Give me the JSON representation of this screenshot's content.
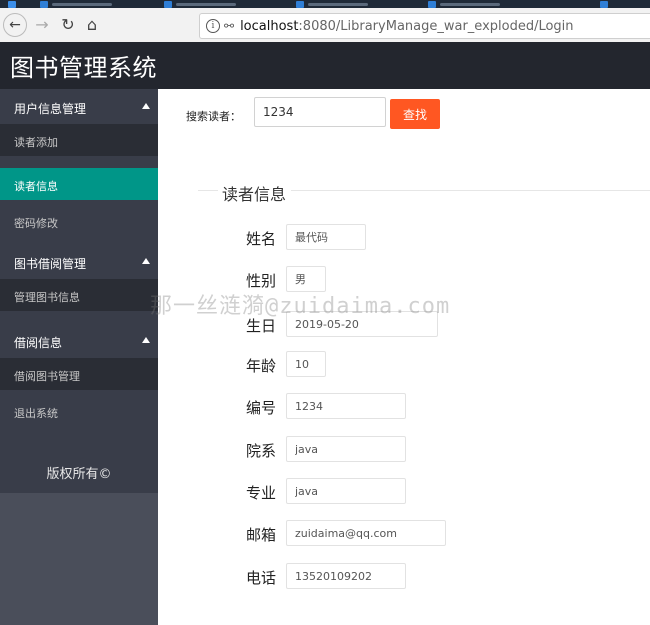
{
  "browser": {
    "url_host": "localhost",
    "url_path": ":8080/LibraryManage_war_exploded/Login"
  },
  "app": {
    "title": "图书管理系统"
  },
  "sidebar": {
    "group_user": "用户信息管理",
    "item_reader_add": "读者添加",
    "item_reader_info": "读者信息",
    "item_password": "密码修改",
    "group_borrow_manage": "图书借阅管理",
    "item_book_manage": "管理图书信息",
    "group_borrow_info": "借阅信息",
    "item_borrow_manage": "借阅图书管理",
    "item_logout": "退出系统",
    "copyright": "版权所有©"
  },
  "search": {
    "label": "搜索读者：",
    "value": "1234",
    "button": "查找"
  },
  "reader": {
    "legend": "读者信息",
    "fields": [
      {
        "label": "姓名",
        "value": "最代码"
      },
      {
        "label": "性别",
        "value": "男"
      },
      {
        "label": "生日",
        "value": "2019-05-20"
      },
      {
        "label": "年龄",
        "value": "10"
      },
      {
        "label": "编号",
        "value": "1234"
      },
      {
        "label": "院系",
        "value": "java"
      },
      {
        "label": "专业",
        "value": "java"
      },
      {
        "label": "邮箱",
        "value": "zuidaima@qq.com"
      },
      {
        "label": "电话",
        "value": "13520109202"
      }
    ]
  },
  "watermark": "那一丝涟漪@zuidaima.com"
}
